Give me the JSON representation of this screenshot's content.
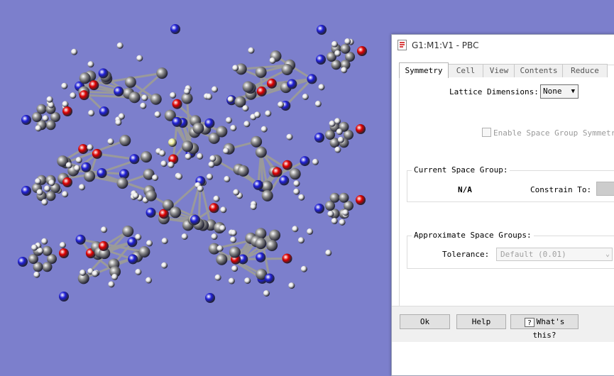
{
  "dialog": {
    "title": "G1:M1:V1 - PBC",
    "tabs": [
      {
        "label": "Symmetry"
      },
      {
        "label": "Cell"
      },
      {
        "label": "View"
      },
      {
        "label": "Contents"
      },
      {
        "label": "Reduce"
      }
    ],
    "active_tab": "Symmetry",
    "lattice_label": "Lattice Dimensions:",
    "lattice_value": "None",
    "enable_symmetry_label": "Enable Space Group Symmetry:",
    "current_group": {
      "title": "Current Space Group:",
      "value": "N/A",
      "constrain_label": "Constrain To:"
    },
    "approx_group": {
      "title": "Approximate Space Groups:",
      "tolerance_label": "Tolerance:",
      "tolerance_value": "Default (0.01)"
    },
    "buttons": {
      "ok": "Ok",
      "help": "Help",
      "whats_this": "What's this?"
    }
  },
  "viewport": {
    "background": "#7c7fcc",
    "atom_colors": {
      "carbon": "#8a8a8a",
      "hydrogen": "#e8e8e8",
      "nitrogen": "#2020d8",
      "oxygen": "#e00000",
      "sulfur": "#f0f0a0"
    }
  }
}
